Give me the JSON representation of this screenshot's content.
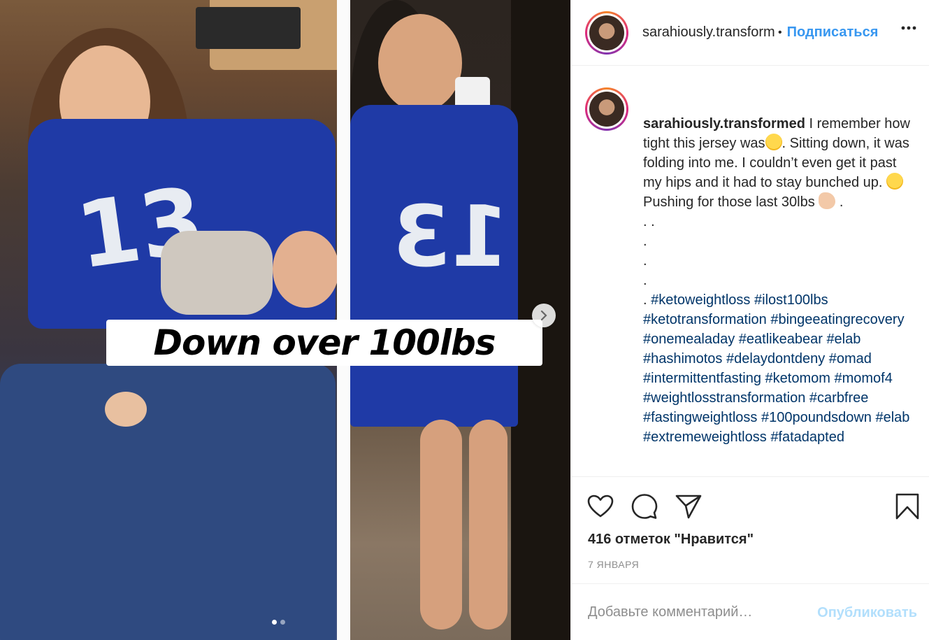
{
  "media": {
    "caption_overlay": "Down over 100lbs",
    "carousel_dots": 2,
    "active_dot": 0
  },
  "header": {
    "username": "sarahiously.transformed",
    "separator": "•",
    "follow_label": "Подписаться",
    "more_icon": "more-icon"
  },
  "post": {
    "username": "sarahiously.transformed",
    "caption_parts": [
      {
        "t": "text",
        "v": " I remember how tight this jersey was"
      },
      {
        "t": "emoji",
        "v": "grin-sweat"
      },
      {
        "t": "text",
        "v": ". Sitting down, it was folding into me. I couldn’t even get it past my hips and it had to stay bunched up. "
      },
      {
        "t": "emoji",
        "v": "grimace"
      },
      {
        "t": "text",
        "v": " Pushing for those last 30lbs "
      },
      {
        "t": "emoji",
        "v": "flexed-biceps"
      },
      {
        "t": "text",
        "v": " .\n. .\n.\n.\n.\n. "
      }
    ],
    "hashtags": [
      "#ketoweightloss",
      "#ilost100lbs",
      "#ketotransformation",
      "#bingeeatingrecovery",
      "#onemealaday",
      "#eatlikeabear",
      "#elab",
      "#hashimotos",
      "#delaydontdeny",
      "#omad",
      "#intermittentfasting",
      "#ketomom",
      "#momof4",
      "#weightlosstransformation",
      "#carbfree",
      "#fastingweightloss",
      "#100poundsdown",
      "#elab",
      "#extremeweightloss",
      "#fatadapted"
    ]
  },
  "actions": {
    "likes": "416 отметок \"Нравится\"",
    "date": "7 ЯНВАРЯ"
  },
  "comment": {
    "placeholder": "Добавьте комментарий…",
    "post_label": "Опубликовать"
  },
  "colors": {
    "accent": "#3897f0",
    "hashtag": "#003569",
    "muted": "#8e8e8e",
    "post_disabled": "#b2dffc"
  }
}
